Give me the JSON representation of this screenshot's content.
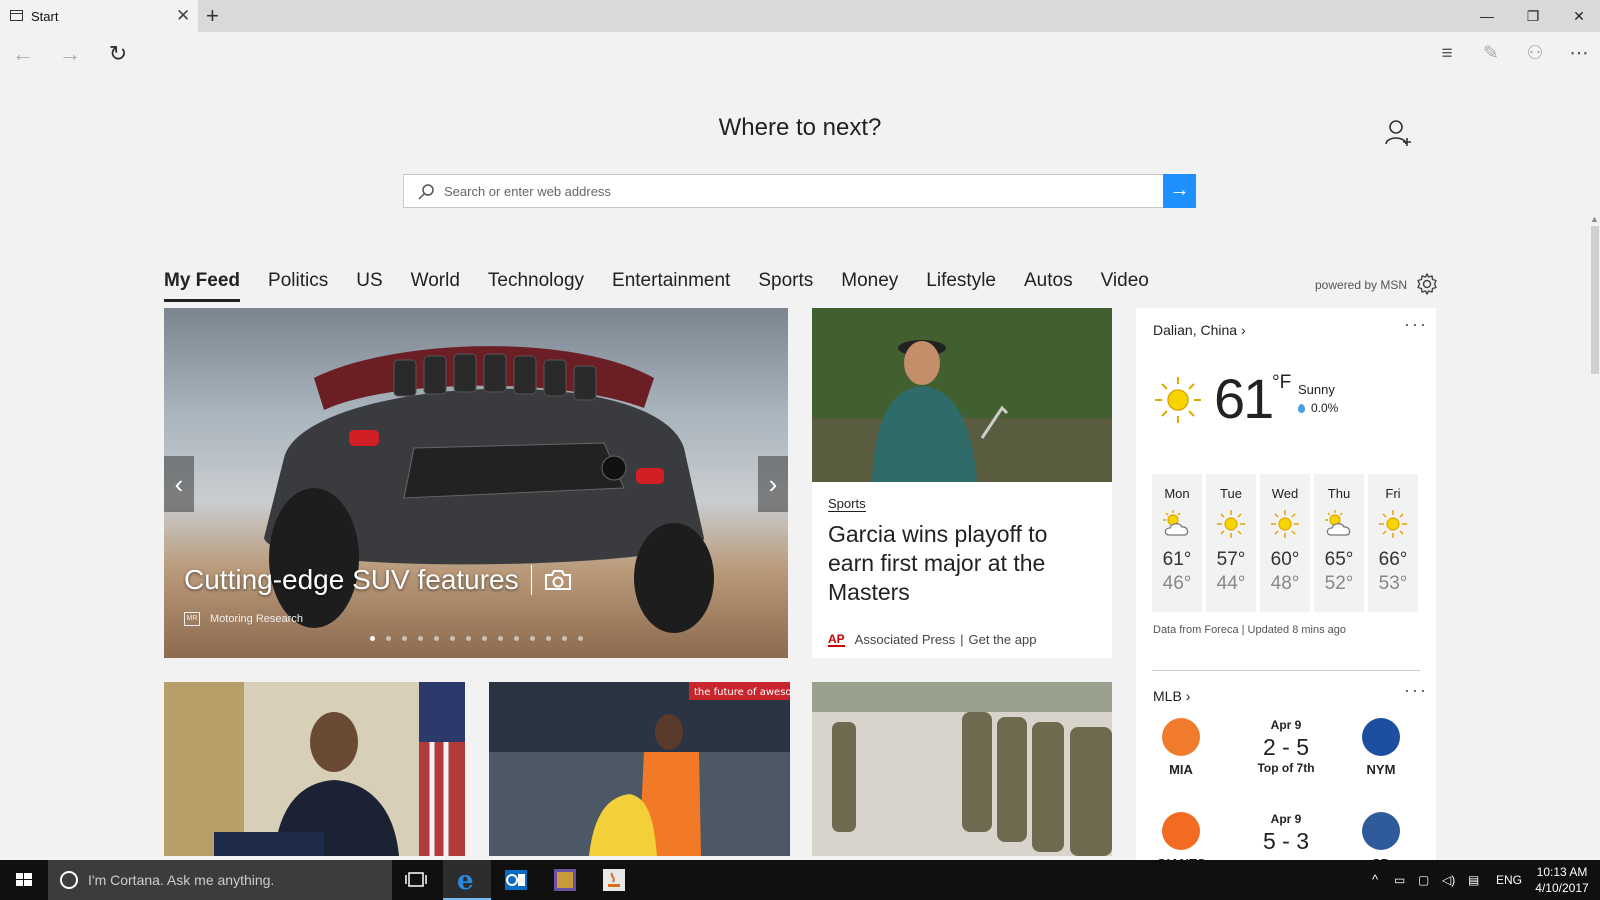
{
  "window": {
    "tab_title": "Start",
    "close_tab": "✕",
    "new_tab": "+",
    "minimize": "—",
    "restore": "❐",
    "close": "✕"
  },
  "toolbar": {
    "back": "←",
    "forward": "→",
    "refresh": "↻",
    "hub": "≡",
    "note": "✎",
    "share": "⚇",
    "more": "⋯"
  },
  "start": {
    "heading": "Where to next?",
    "search_placeholder": "Search or enter web address",
    "go": "→"
  },
  "feed": {
    "tabs": [
      "My Feed",
      "Politics",
      "US",
      "World",
      "Technology",
      "Entertainment",
      "Sports",
      "Money",
      "Lifestyle",
      "Autos",
      "Video"
    ],
    "active_tab": "My Feed",
    "powered_by": "powered by MSN"
  },
  "hero": {
    "caption": "Cutting-edge SUV features",
    "source": "Motoring Research",
    "source_logo": "MR",
    "slide_count": 14,
    "current_slide": 1,
    "prev": "‹",
    "next": "›"
  },
  "golf_card": {
    "category": "Sports",
    "title": "Garcia wins playoff to earn first major at the Masters",
    "publisher_logo": "AP",
    "publisher": "Associated Press",
    "get_app": "Get the app"
  },
  "tiles": {
    "tile2_banner": "the future of awesome"
  },
  "weather": {
    "location": "Dalian, China",
    "temp": "61",
    "unit": "°F",
    "condition": "Sunny",
    "precip": "0.0%",
    "days": [
      {
        "name": "Mon",
        "hi": "61°",
        "lo": "46°",
        "icon": "partly-cloudy-icon"
      },
      {
        "name": "Tue",
        "hi": "57°",
        "lo": "44°",
        "icon": "sun-icon"
      },
      {
        "name": "Wed",
        "hi": "60°",
        "lo": "48°",
        "icon": "sun-icon"
      },
      {
        "name": "Thu",
        "hi": "65°",
        "lo": "52°",
        "icon": "partly-cloudy-icon"
      },
      {
        "name": "Fri",
        "hi": "66°",
        "lo": "53°",
        "icon": "sun-icon"
      }
    ],
    "footer": "Data from Foreca | Updated 8 mins ago"
  },
  "mlb": {
    "title": "MLB",
    "games": [
      {
        "date": "Apr 9",
        "score": "2 - 5",
        "status": "Top of 7th",
        "home": "MIA",
        "away": "NYM",
        "home_color": "#f07b2a",
        "away_color": "#1d4fa0"
      },
      {
        "date": "Apr 9",
        "score": "5 - 3",
        "status": "",
        "home": "GIANTS",
        "away": "SD",
        "home_color": "#f26b21",
        "away_color": "#2f5a9b"
      }
    ]
  },
  "taskbar": {
    "cortana_placeholder": "I'm Cortana. Ask me anything.",
    "language": "ENG",
    "time": "10:13 AM",
    "date": "4/10/2017"
  },
  "colors": {
    "accent": "#1e90ff",
    "taskbar": "#101010"
  }
}
